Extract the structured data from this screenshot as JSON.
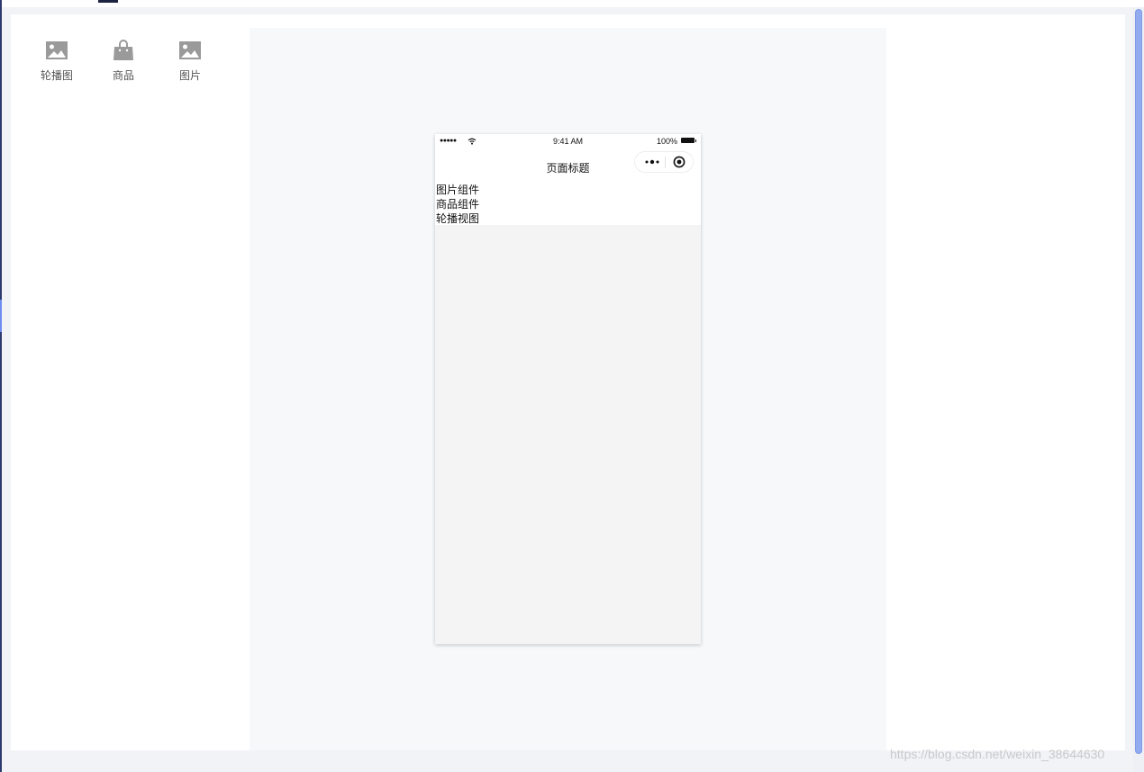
{
  "palette": {
    "items": [
      {
        "label": "轮播图",
        "icon": "image-icon"
      },
      {
        "label": "商品",
        "icon": "shopping-bag-icon"
      },
      {
        "label": "图片",
        "icon": "image-icon"
      }
    ]
  },
  "phone": {
    "status_bar": {
      "signal": "●●●●●",
      "time": "9:41 AM",
      "battery": "100%"
    },
    "nav": {
      "title": "页面标题"
    },
    "components": [
      {
        "label": "图片组件"
      },
      {
        "label": "商品组件"
      },
      {
        "label": "轮播视图"
      }
    ]
  },
  "watermark": "https://blog.csdn.net/weixin_38644630",
  "colors": {
    "panel": "#ffffff",
    "canvas": "#f7f8fa",
    "phone_body": "#f4f4f4",
    "icon_gray": "#9a9a9a",
    "scroll_thumb": "#93acf0"
  }
}
